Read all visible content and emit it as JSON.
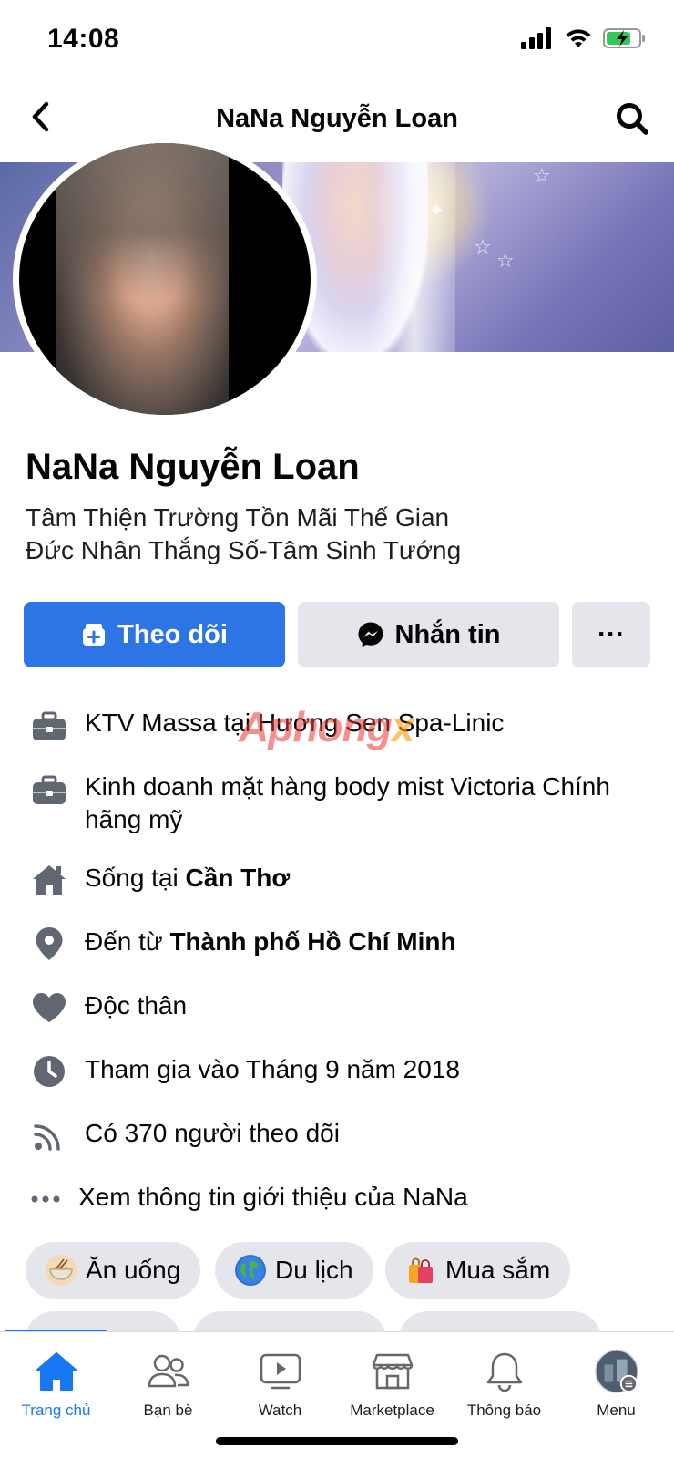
{
  "status_bar": {
    "time": "14:08"
  },
  "nav": {
    "title": "NaNa Nguyễn Loan"
  },
  "profile": {
    "name": "NaNa Nguyễn Loan",
    "bio_line1": "Tâm Thiện Trường Tồn Mãi Thế Gian",
    "bio_line2": "Đức Nhân Thắng Số-Tâm Sinh Tướng"
  },
  "actions": {
    "follow_label": "Theo dõi",
    "message_label": "Nhắn tin",
    "more_label": "···"
  },
  "details": {
    "work1": "KTV Massa tại Hương Sen Spa-Linic",
    "work2": "Kinh doanh mặt hàng body mist Victoria Chính hãng mỹ",
    "lives_prefix": "Sống tại ",
    "lives_place": "Cần Thơ",
    "from_prefix": "Đến từ ",
    "from_place": "Thành phố Hồ Chí Minh",
    "relationship": "Độc thân",
    "joined": "Tham gia vào Tháng 9 năm 2018",
    "followers": "Có 370 người theo dõi",
    "see_about": "Xem thông tin giới thiệu của NaNa"
  },
  "watermark": {
    "main": "Aphong",
    "suffix": "x"
  },
  "hobbies": [
    {
      "label": "Ăn uống",
      "icon": "noodle-bowl-icon"
    },
    {
      "label": "Du lịch",
      "icon": "globe-icon"
    },
    {
      "label": "Mua sắm",
      "icon": "shopping-bags-icon"
    }
  ],
  "tabbar": {
    "active_color": "#1877f2",
    "items": [
      {
        "label": "Trang chủ",
        "icon": "home-icon",
        "active": true
      },
      {
        "label": "Bạn bè",
        "icon": "friends-icon",
        "active": false
      },
      {
        "label": "Watch",
        "icon": "watch-icon",
        "active": false
      },
      {
        "label": "Marketplace",
        "icon": "marketplace-icon",
        "active": false
      },
      {
        "label": "Thông báo",
        "icon": "bell-icon",
        "active": false
      },
      {
        "label": "Menu",
        "icon": "menu-avatar-icon",
        "active": false
      }
    ]
  },
  "colors": {
    "primary": "#2d74e5",
    "secondary_button": "#e4e6eb",
    "icon_gray": "#606770"
  }
}
